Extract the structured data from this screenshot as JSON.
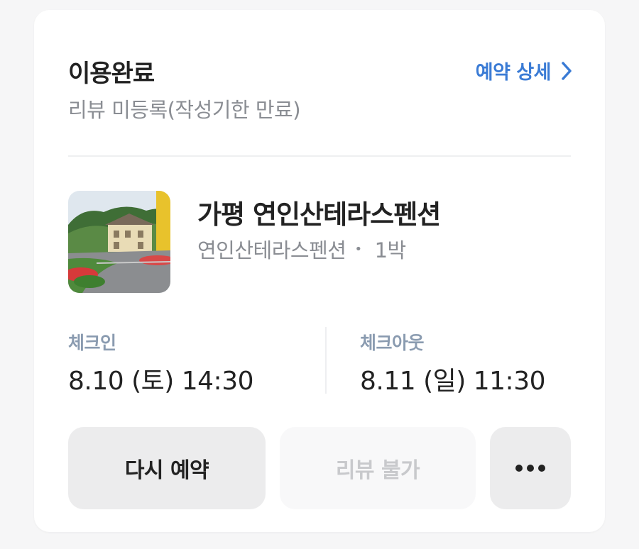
{
  "booking": {
    "status_title": "이용완료",
    "detail_link_label": "예약 상세",
    "review_status": "리뷰 미등록(작성기한 만료)"
  },
  "property": {
    "name": "가평 연인산테라스펜션",
    "room_name": "연인산테라스펜션",
    "separator": "•",
    "nights": "1박"
  },
  "stay": {
    "checkin_label": "체크인",
    "checkin_value": "8.10 (토) 14:30",
    "checkout_label": "체크아웃",
    "checkout_value": "8.11 (일) 11:30"
  },
  "actions": {
    "rebook_label": "다시 예약",
    "review_label": "리뷰 불가",
    "more_label": "more-options"
  },
  "colors": {
    "accent": "#3a7bd5",
    "muted_label": "#8a9bb0",
    "secondary_text": "#8a8d93",
    "primary_text": "#222222"
  },
  "icons": {
    "detail": "chevron-right-icon",
    "more": "ellipsis-icon"
  }
}
